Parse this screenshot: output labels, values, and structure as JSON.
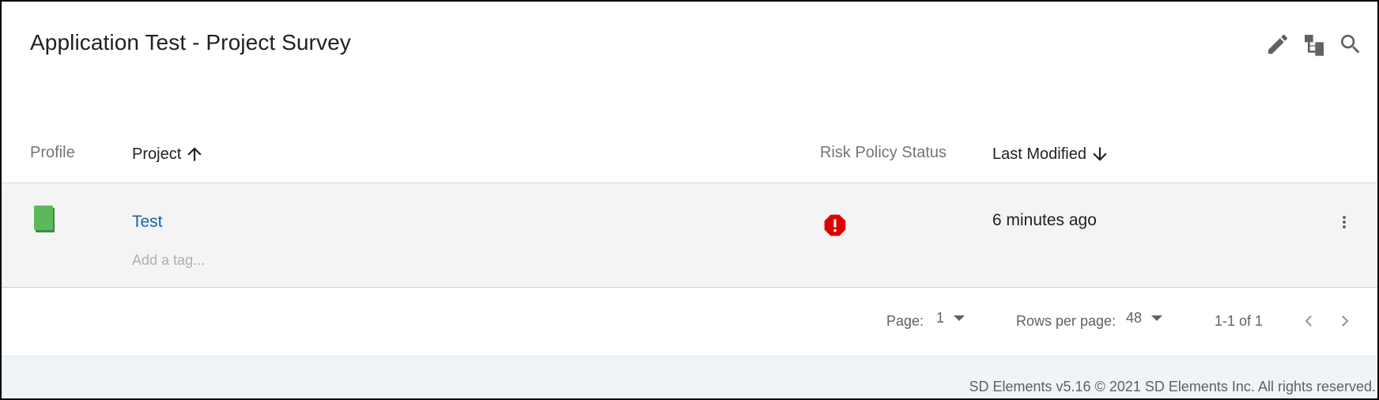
{
  "header": {
    "title": "Application Test - Project Survey",
    "actions": [
      {
        "name": "edit",
        "icon": "pencil-icon"
      },
      {
        "name": "hierarchy",
        "icon": "hierarchy-icon"
      },
      {
        "name": "search",
        "icon": "search-icon"
      }
    ]
  },
  "table": {
    "columns": {
      "profile": "Profile",
      "project": "Project",
      "risk": "Risk Policy Status",
      "modified": "Last Modified"
    },
    "sort": {
      "project": "ascending",
      "modified": "descending"
    },
    "rows": [
      {
        "profile_icon": "green-document-icon",
        "project": "Test",
        "tag_placeholder": "Add a tag...",
        "risk_icon": "error-octagon-icon",
        "last_modified": "6 minutes ago"
      }
    ]
  },
  "pagination": {
    "page_label": "Page:",
    "page_value": "1",
    "rows_label": "Rows per page:",
    "rows_value": "48",
    "range": "1-1 of 1"
  },
  "footer": {
    "text": "SD Elements v5.16 © 2021 SD Elements Inc. All rights reserved."
  },
  "colors": {
    "link": "#1d62a6",
    "profile_green": "#5cb85c",
    "risk_red": "#e00000",
    "row_bg": "#f4f4f4",
    "footer_bg": "#f0f3f8"
  }
}
